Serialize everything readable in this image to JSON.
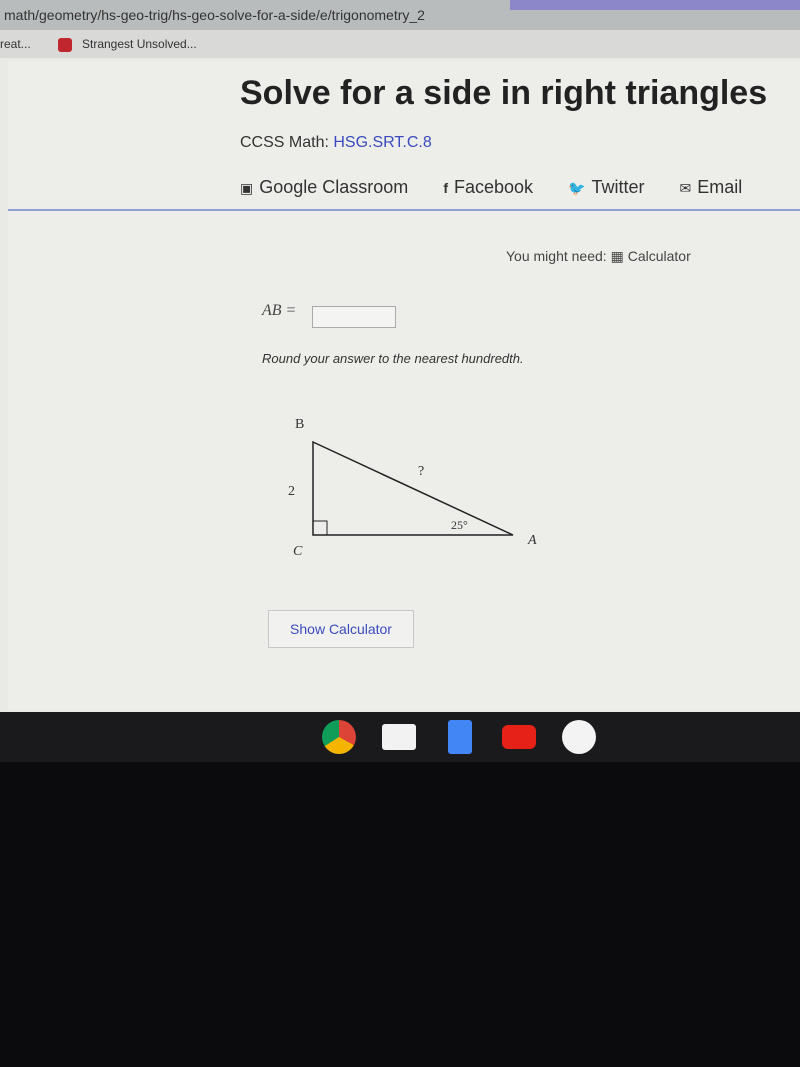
{
  "browser": {
    "url": "math/geometry/hs-geo-trig/hs-geo-solve-for-a-side/e/trigonometry_2",
    "bookmarks": [
      {
        "label": "reat..."
      },
      {
        "label": "Strangest Unsolved..."
      }
    ]
  },
  "header": {
    "title": "Solve for a side in right triangles",
    "ccss_label": "CCSS Math:",
    "ccss_code": "HSG.SRT.C.8",
    "share": [
      {
        "label": "Google Classroom",
        "icon": "google-classroom-icon"
      },
      {
        "label": "Facebook",
        "icon": "facebook-icon"
      },
      {
        "label": "Twitter",
        "icon": "twitter-icon"
      },
      {
        "label": "Email",
        "icon": "email-icon"
      }
    ]
  },
  "problem": {
    "might_need": "You might need:",
    "calculator": "Calculator",
    "answer_label": "AB =",
    "answer_value": "",
    "instruction": "Round your answer to the nearest hundredth.",
    "triangle": {
      "vertex_b": "B",
      "vertex_c": "C",
      "vertex_a": "A",
      "side_bc": "2",
      "side_ab": "?",
      "angle_a": "25°"
    },
    "show_calculator": "Show Calculator"
  },
  "taskbar": {
    "apps": [
      "chrome",
      "gmail",
      "docs",
      "youtube",
      "play-store"
    ]
  },
  "colors": {
    "link": "#3b4bbd",
    "divider": "#8ea2d4"
  }
}
